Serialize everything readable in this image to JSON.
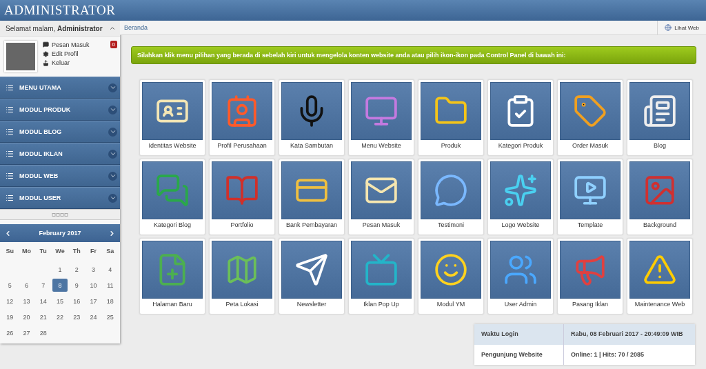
{
  "header": {
    "title": "ADMINISTRATOR"
  },
  "user_panel": {
    "greeting": "Selamat malam, **Administrator**",
    "expanded": true,
    "links": [
      {
        "label": "Pesan Masuk",
        "badge": "0"
      },
      {
        "label": "Edit Profil"
      },
      {
        "label": "Keluar"
      }
    ]
  },
  "sidebar": {
    "items": [
      {
        "label": "MENU UTAMA",
        "expanded": false
      },
      {
        "label": "MODUL PRODUK",
        "expanded": false
      },
      {
        "label": "MODUL BLOG",
        "expanded": false
      },
      {
        "label": "MODUL IKLAN",
        "expanded": false
      },
      {
        "label": "MODUL WEB",
        "expanded": false
      },
      {
        "label": "MODUL USER",
        "expanded": false
      }
    ]
  },
  "calendar": {
    "title": "February 2017",
    "weekdays": [
      "Su",
      "Mo",
      "Tu",
      "We",
      "Th",
      "Fr",
      "Sa"
    ],
    "weeks": [
      [
        {
          "label": "1",
          "selected": false
        },
        {
          "label": "2",
          "selected": false
        },
        {
          "label": "3",
          "selected": false
        },
        {
          "label": "4",
          "selected": false
        }
      ],
      [
        {
          "label": "5",
          "selected": false
        },
        {
          "label": "6",
          "selected": false
        },
        {
          "label": "7",
          "selected": false
        },
        {
          "label": "8",
          "selected": true
        },
        {
          "label": "9",
          "selected": false
        },
        {
          "label": "10",
          "selected": false
        },
        {
          "label": "11",
          "selected": false
        }
      ],
      [
        {
          "label": "12",
          "selected": false
        },
        {
          "label": "13",
          "selected": false
        },
        {
          "label": "14",
          "selected": false
        },
        {
          "label": "15",
          "selected": false
        },
        {
          "label": "16",
          "selected": false
        },
        {
          "label": "17",
          "selected": false
        },
        {
          "label": "18",
          "selected": false
        }
      ],
      [
        {
          "label": "19",
          "selected": false
        },
        {
          "label": "20",
          "selected": false
        },
        {
          "label": "21",
          "selected": false
        },
        {
          "label": "22",
          "selected": false
        },
        {
          "label": "23",
          "selected": false
        },
        {
          "label": "24",
          "selected": false
        },
        {
          "label": "25",
          "selected": false
        }
      ],
      [
        {
          "label": "26",
          "selected": false
        },
        {
          "label": "27",
          "selected": false
        },
        {
          "label": "28",
          "selected": false
        }
      ]
    ]
  },
  "breadcrumb": "Beranda",
  "view_site_button": "Lihat Web",
  "notice": "Silahkan klik menu pilihan yang berada di sebelah kiri untuk mengelola konten website anda atau pilih ikon-ikon pada Control Panel di bawah ini:",
  "control_panel": [
    "Identitas Website",
    "Profil Perusahaan",
    "Kata Sambutan",
    "Menu Website",
    "Produk",
    "Kategori Produk",
    "Order Masuk",
    "Blog",
    "Kategori Blog",
    "Portfolio",
    "Bank Pembayaran",
    "Pesan Masuk",
    "Testimoni",
    "Logo Website",
    "Template",
    "Background",
    "Halaman Baru",
    "Peta Lokasi",
    "Newsletter",
    "Iklan Pop Up",
    "Modul YM",
    "User Admin",
    "Pasang Iklan",
    "Maintenance Web"
  ],
  "info_table": [
    {
      "label": "Waktu Login",
      "value": "Rabu, 08 Februari 2017 - 20:49:09 WIB"
    },
    {
      "label": "Pengunjung Website",
      "value": "Online: 1 | Hits: 70 / 2085"
    }
  ]
}
